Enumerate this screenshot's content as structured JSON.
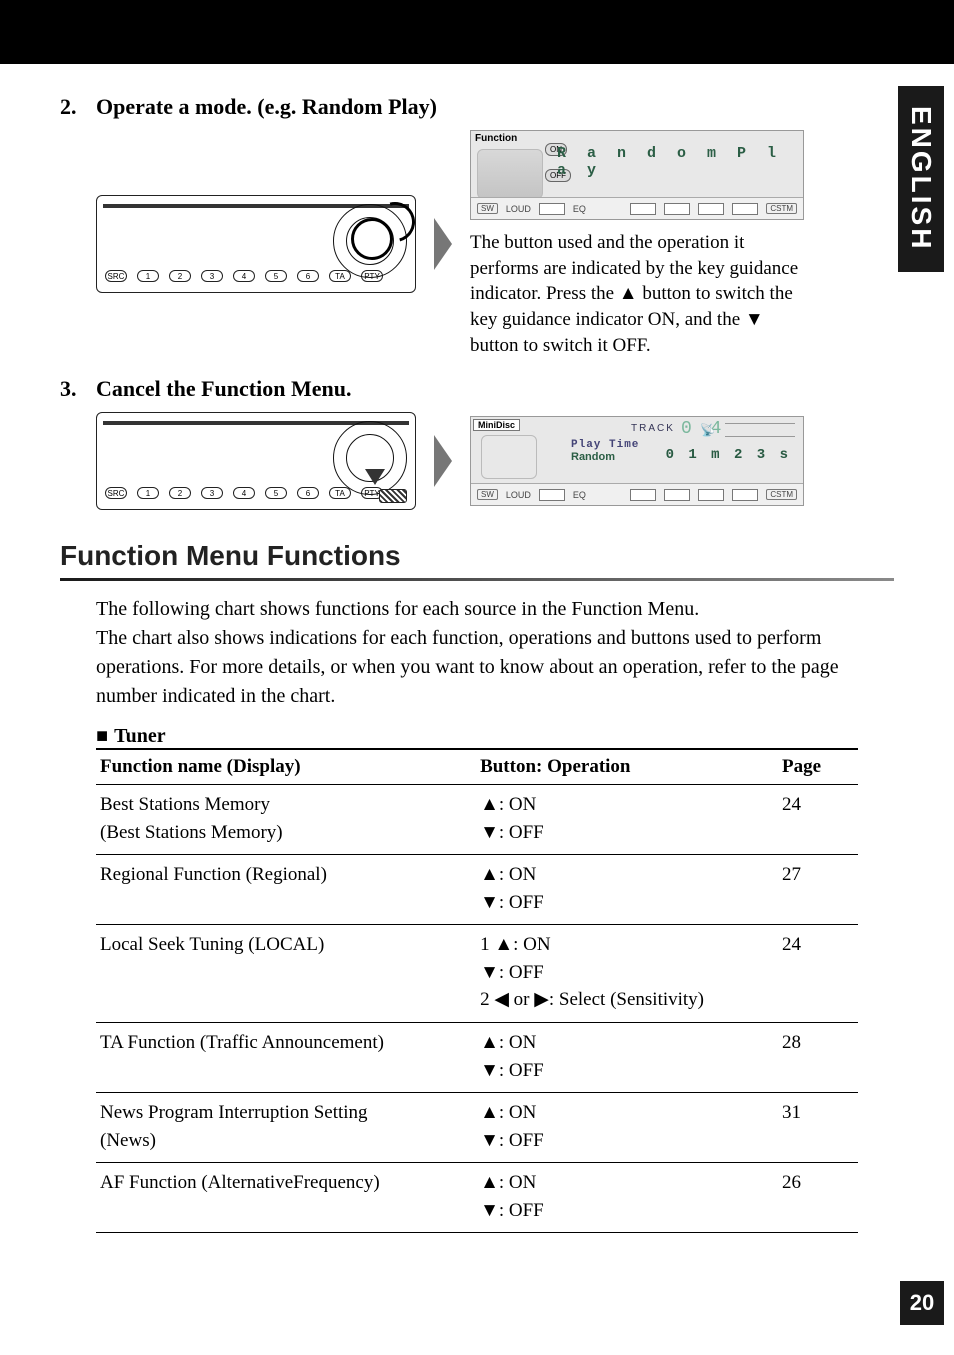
{
  "side_tab": "ENGLISH",
  "page_number": "20",
  "steps": {
    "s2": {
      "num": "2.",
      "title": "Operate a mode. (e.g. Random Play)"
    },
    "s3": {
      "num": "3.",
      "title": "Cancel the Function Menu."
    }
  },
  "display1": {
    "header": "Function",
    "main": "R a n d o m P l a y",
    "on": "ON",
    "off": "OFF",
    "bottom": {
      "sw": "SW",
      "loud": "LOUD",
      "eq": "EQ",
      "cstm": "CSTM"
    }
  },
  "explain": "The button used and the operation it performs are indicated by the key guidance indicator. Press the ▲ button to switch the key guidance indicator ON, and the ▼ button to switch it OFF.",
  "display2": {
    "header": "MiniDisc",
    "track_label": "TRACK",
    "track_num": "0 4",
    "play_time": "Play Time",
    "sub": "Random",
    "time": "0 1 m 2 3 s",
    "bottom": {
      "sw": "SW",
      "loud": "LOUD",
      "eq": "EQ",
      "cstm": "CSTM"
    }
  },
  "section": {
    "heading": "Function Menu Functions",
    "intro": "The following chart shows functions for each source in the Function Menu.\nThe chart also shows indications for each function, operations and buttons used to perform operations. For more details, or when you want to know about an operation, refer to the page number indicated in the chart.",
    "sub_heading": "Tuner"
  },
  "chart_data": {
    "type": "table",
    "columns": [
      "Function name (Display)",
      "Button: Operation",
      "Page"
    ],
    "rows": [
      {
        "name": "Best Stations Memory\n(Best Stations Memory)",
        "op": "▲: ON\n▼: OFF",
        "page": "24"
      },
      {
        "name": "Regional Function (Regional)",
        "op": "▲: ON\n▼: OFF",
        "page": "27"
      },
      {
        "name": "Local Seek Tuning (LOCAL)",
        "op": "1 ▲: ON\n   ▼: OFF\n2 ◀ or ▶: Select (Sensitivity)",
        "page": "24"
      },
      {
        "name": "TA Function (Traffic Announcement)",
        "op": "▲: ON\n▼: OFF",
        "page": "28"
      },
      {
        "name": "News Program Interruption Setting\n(News)",
        "op": "▲: ON\n▼: OFF",
        "page": "31"
      },
      {
        "name": "AF Function (AlternativeFrequency)",
        "op": "▲: ON\n▼: OFF",
        "page": "26"
      }
    ]
  },
  "table_headers": {
    "c1": "Function name (Display)",
    "c2": "Button: Operation",
    "c3": "Page"
  }
}
